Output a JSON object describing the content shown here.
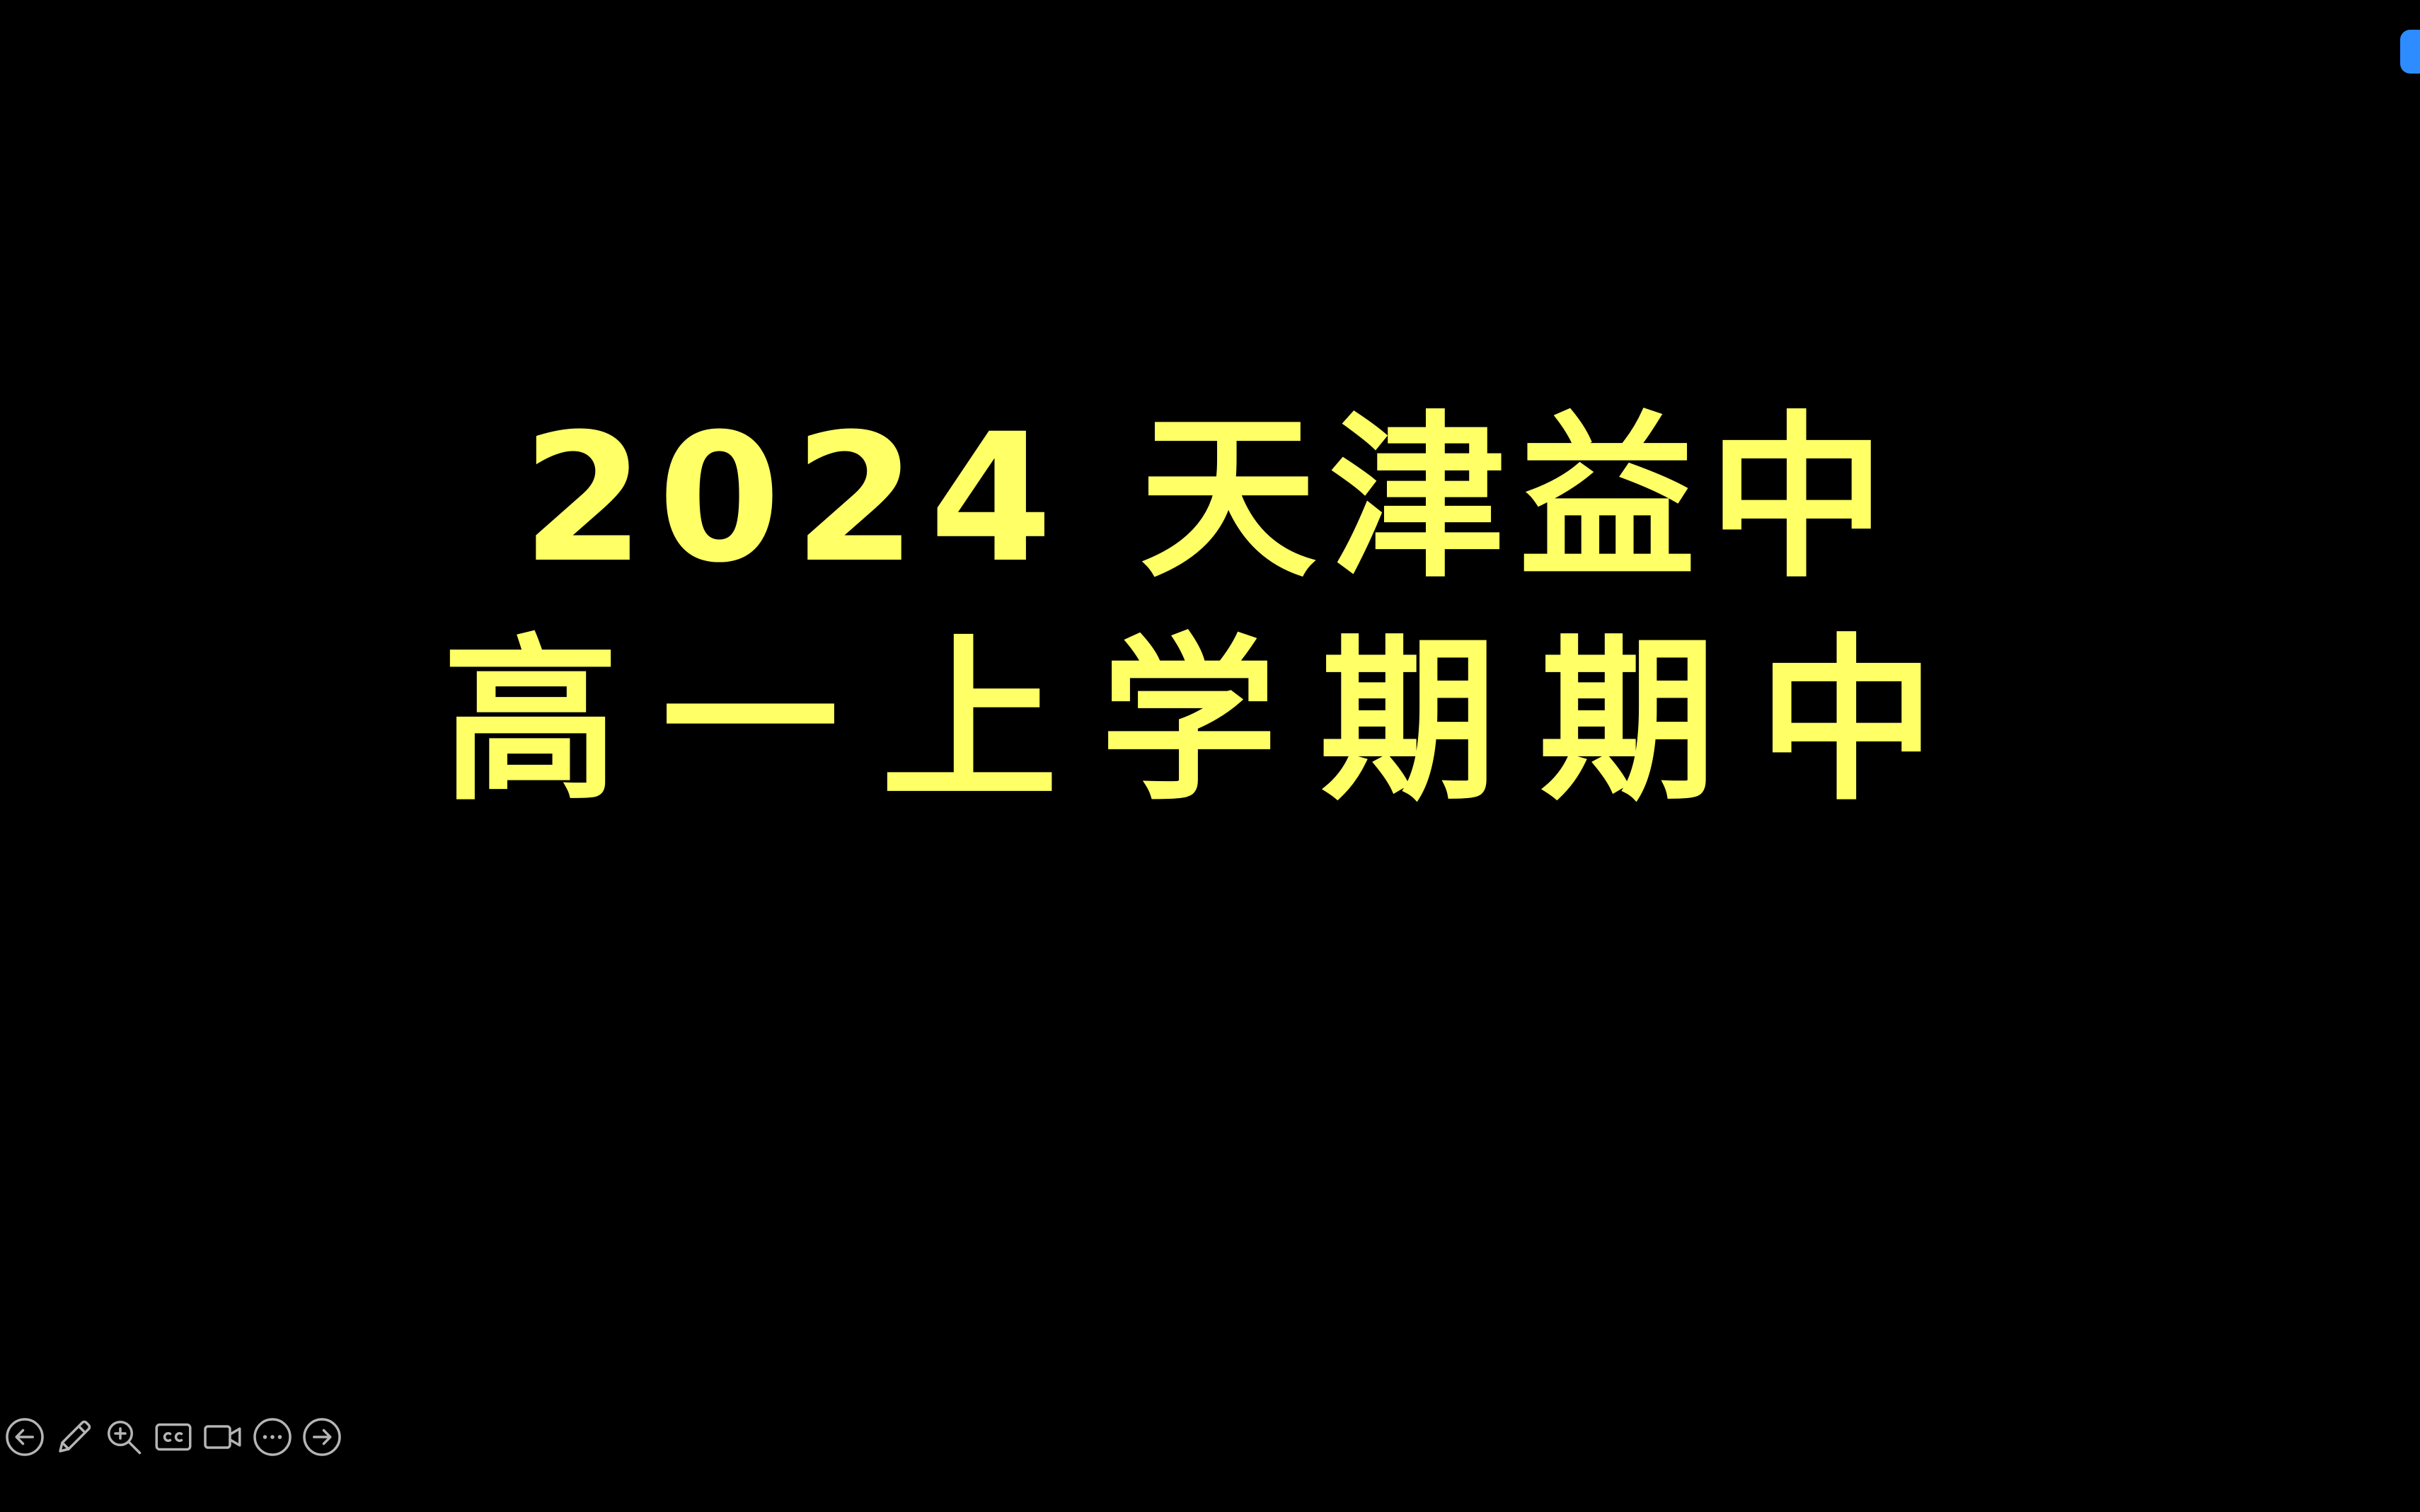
{
  "slide": {
    "title_line_1": "2024 天津益中",
    "title_line_2": "高一上学期期中",
    "background_color": "#000000",
    "text_color": "#FFFF66"
  },
  "corner_badge": {
    "color": "#2D8CFF"
  },
  "toolbar": {
    "items": [
      {
        "icon": "arrow-left-circle-icon"
      },
      {
        "icon": "pen-icon"
      },
      {
        "icon": "zoom-icon"
      },
      {
        "icon": "closed-caption-icon"
      },
      {
        "icon": "video-camera-icon"
      },
      {
        "icon": "more-options-icon"
      },
      {
        "icon": "arrow-right-circle-icon"
      }
    ],
    "icon_color": "#B5B5B5"
  }
}
